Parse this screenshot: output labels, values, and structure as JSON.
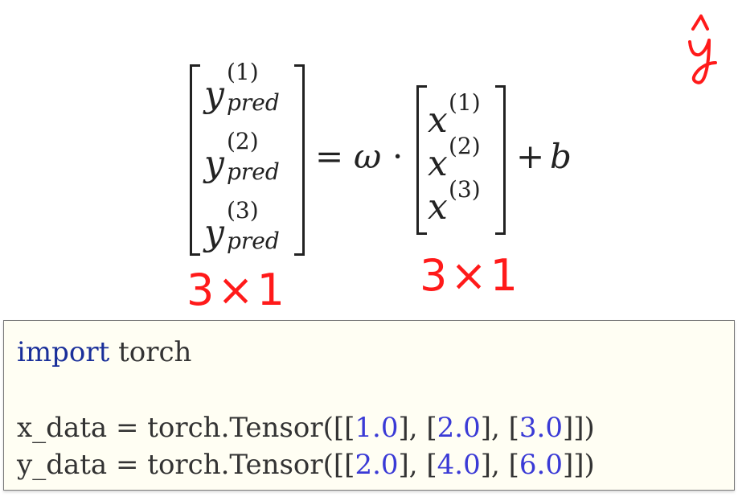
{
  "equation": {
    "lhs_var": "y",
    "lhs_subscript": "pred",
    "lhs_superscripts": [
      "(1)",
      "(2)",
      "(3)"
    ],
    "equals": "=",
    "omega": "ω",
    "dot": "·",
    "rhs_var": "x",
    "rhs_superscripts": [
      "(1)",
      "(2)",
      "(3)"
    ],
    "plus": "+",
    "bias": "b"
  },
  "annotations": {
    "lhs_dim": "3×1",
    "rhs_dim": "3×1",
    "corner_symbol": "ŷ"
  },
  "code": {
    "line1_keyword": "import",
    "line1_rest": " torch",
    "line3_prefix": "x_data = torch.Tensor([[",
    "line4_prefix": "y_data = torch.Tensor([[",
    "x_values": [
      "1.0",
      "2.0",
      "3.0"
    ],
    "y_values": [
      "2.0",
      "4.0",
      "6.0"
    ],
    "sep": "], [",
    "suffix": "]])"
  },
  "colors": {
    "handwriting": "#ff1a1a",
    "code_background": "#fffef3",
    "keyword": "#1a2f9a",
    "number": "#3a3ad6"
  }
}
